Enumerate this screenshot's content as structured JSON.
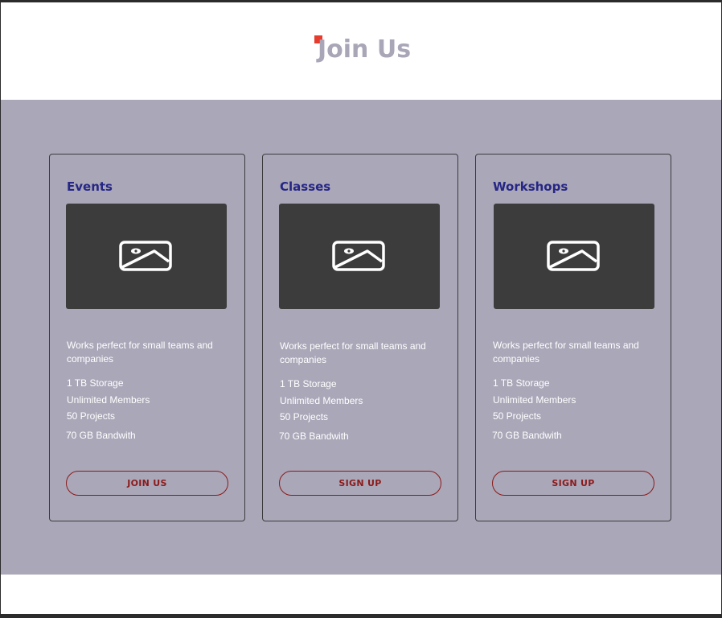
{
  "header": {
    "title": "Join Us",
    "accent_color": "#e63c2e"
  },
  "cards": [
    {
      "title": "Events",
      "image_icon": "image-placeholder-icon",
      "description": "Works perfect for small teams and companies",
      "features": [
        "1 TB Storage",
        "Unlimited Members",
        "50 Projects",
        "70 GB Bandwith"
      ],
      "button_label": "JOIN US"
    },
    {
      "title": "Classes",
      "image_icon": "image-placeholder-icon",
      "description": "Works perfect for small teams and companies",
      "features": [
        "1 TB Storage",
        "Unlimited Members",
        "50 Projects",
        "70 GB Bandwith"
      ],
      "button_label": "SIGN UP"
    },
    {
      "title": "Workshops",
      "image_icon": "image-placeholder-icon",
      "description": "Works perfect for small teams and companies",
      "features": [
        "1 TB Storage",
        "Unlimited Members",
        "50 Projects",
        "70 GB Bandwith"
      ],
      "button_label": "SIGN UP"
    }
  ],
  "colors": {
    "band_background": "#aaa7b8",
    "card_title": "#262686",
    "button_text": "#8b1a1a",
    "image_background": "#3c3c3c"
  }
}
